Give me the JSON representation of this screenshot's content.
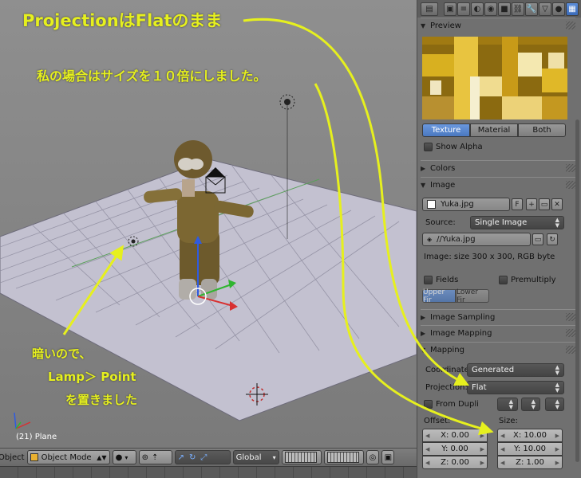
{
  "annotations": {
    "projection_note": "ProjectionはFlatのまま",
    "size_note": "私の場合はサイズを１０倍にしました。",
    "lamp_line1": "暗いので、",
    "lamp_line2": "Lamp＞ Point",
    "lamp_line3": "を置きました"
  },
  "viewport": {
    "frame_label": "(21) Plane"
  },
  "header": {
    "object_label": "Object",
    "mode": "Object Mode",
    "orientation": "Global"
  },
  "panel": {
    "sections": {
      "preview": "Preview",
      "colors": "Colors",
      "image": "Image",
      "image_sampling": "Image Sampling",
      "image_mapping": "Image Mapping",
      "mapping": "Mapping"
    },
    "preview_tabs": [
      "Texture",
      "Material",
      "Both"
    ],
    "show_alpha": "Show Alpha",
    "image_name": "Yuka.jpg",
    "image_flag": "F",
    "source_label": "Source:",
    "source_value": "Single Image",
    "filepath": "//Yuka.jpg",
    "image_info": "Image: size 300 x 300, RGB byte",
    "fields": "Fields",
    "premultiply": "Premultiply",
    "upper_first": "Upper Fir",
    "lower_first": "Lower Fir",
    "coordinates_label": "Coordinates:",
    "coordinates_value": "Generated",
    "projection_label": "Projection:",
    "projection_value": "Flat",
    "from_dupli": "From Dupli",
    "offset_label": "Offset:",
    "size_label": "Size:",
    "offset": [
      "X: 0.00",
      "Y: 0.00",
      "Z: 0.00"
    ],
    "size": [
      "X: 10.00",
      "Y: 10.00",
      "Z: 1.00"
    ]
  },
  "colors": {
    "annotation": "#e6f01e",
    "active_tab": "#4a78c0"
  }
}
